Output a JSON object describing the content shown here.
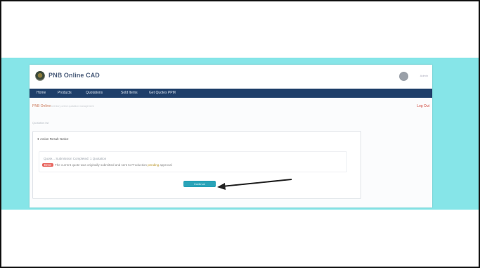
{
  "app": {
    "title": "PNB Online CAD",
    "user_name": "Admin"
  },
  "nav": {
    "items": [
      "Home",
      "Products",
      "Quotations",
      "Sold Items",
      "Get Quotes PPM"
    ]
  },
  "breadcrumb": {
    "title": "PNB Online",
    "subtitle": "Inventory online quotation management",
    "right_link": "Log Out"
  },
  "section_label": "Quotation list",
  "panel": {
    "title": "Action Result Notice",
    "message": "Quote... Submission Completed: 1 Quotation",
    "badge": "Error",
    "detail": "The current quote was originally submitted and sent to Production ",
    "detail_highlight": "pending",
    "detail_tail": " approval"
  },
  "button": {
    "label": "Continue"
  },
  "colors": {
    "band": "#86e5e8",
    "nav": "#1f3f6a",
    "button": "#2aa3b8",
    "badge": "#e8665f"
  }
}
